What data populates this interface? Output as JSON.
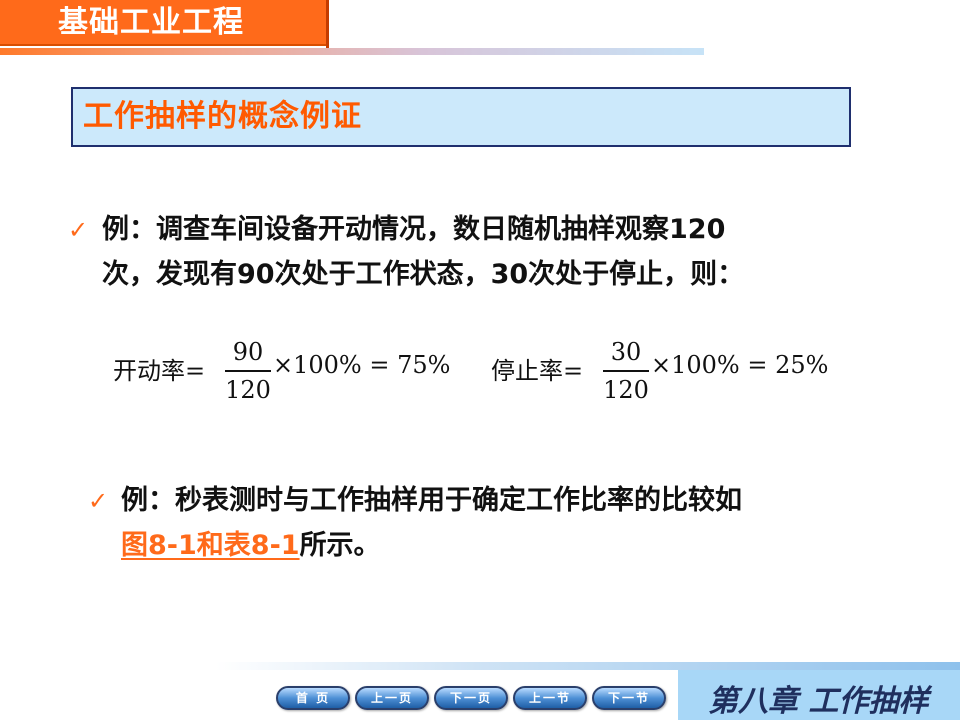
{
  "header": {
    "course_title": "基础工业工程"
  },
  "section_title": "工作抽样的概念例证",
  "example1": {
    "line1": "例：调查车间设备开动情况，数日随机抽样观察120",
    "line2": "次，发现有90次处于工作状态，30次处于停止，则："
  },
  "formula_running": {
    "label": "开动率",
    "eq": "=",
    "numerator": "90",
    "denominator": "120",
    "rest": "×100% = 75%"
  },
  "formula_idle": {
    "label": "停止率",
    "eq": "=",
    "numerator": "30",
    "denominator": "120",
    "rest": "×100% = 25%"
  },
  "example2": {
    "line1": "例：秒表测时与工作抽样用于确定工作比率的比较如",
    "link_text": "图8-1和表8-1",
    "line2_suffix": "所示。"
  },
  "nav": {
    "home": "首 页",
    "prev_page": "上一页",
    "next_page": "下一页",
    "prev_section": "上一节",
    "next_section": "下一节"
  },
  "chapter_label": "第八章  工作抽样",
  "colors": {
    "accent_orange": "#ff6a1a",
    "title_box_bg": "#cce9fb",
    "title_box_border": "#1f2f6e",
    "chapter_bg": "#a8d7f7"
  }
}
